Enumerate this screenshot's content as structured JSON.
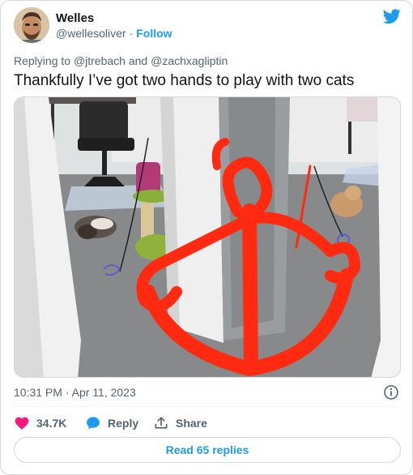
{
  "author": {
    "name": "Welles",
    "handle": "@wellesoliver",
    "separator": "·",
    "follow_label": "Follow"
  },
  "reply_context": {
    "prefix": "Replying to",
    "mention_1": "@jtrebach",
    "conjunction": "and",
    "mention_2": "@zachxagliptin"
  },
  "tweet": {
    "text": "Thankfully I’ve got two hands to play with two cats"
  },
  "meta": {
    "time": "10:31 PM",
    "separator": "·",
    "date": "Apr 11, 2023"
  },
  "actions": {
    "likes": "34.7K",
    "reply_label": "Reply",
    "share_label": "Share"
  },
  "read_replies_label": "Read 65 replies",
  "colors": {
    "accent": "#1d9bf0",
    "like": "#f91880",
    "secondary_text": "#536471",
    "drawing": "#ff2a10"
  },
  "icons": {
    "brand": "twitter-bird-icon",
    "info": "info-icon",
    "like": "heart-icon",
    "reply": "reply-bubble-icon",
    "share": "share-icon"
  }
}
